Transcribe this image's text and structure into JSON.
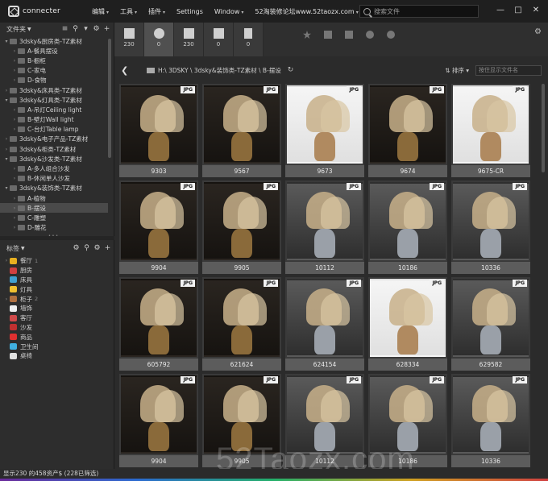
{
  "app": {
    "name": "connecter"
  },
  "menu": [
    {
      "label": "编辑",
      "caret": true
    },
    {
      "label": "工具",
      "caret": true
    },
    {
      "label": "插件",
      "caret": true
    },
    {
      "label": "Settings",
      "caret": false
    },
    {
      "label": "Window",
      "caret": true
    },
    {
      "label": "52淘装修论坛www.52taozx.com",
      "caret": true
    }
  ],
  "search": {
    "placeholder": "搜索文件"
  },
  "folders": {
    "title": "文件夹",
    "items": [
      {
        "label": "3dsky&厨房类-TZ素材",
        "level": 0,
        "expanded": true
      },
      {
        "label": "A-餐具摆设",
        "level": 1
      },
      {
        "label": "B-橱柜",
        "level": 1
      },
      {
        "label": "C-家电",
        "level": 1
      },
      {
        "label": "D-食物",
        "level": 1
      },
      {
        "label": "3dsky&床具类-TZ素材",
        "level": 0
      },
      {
        "label": "3dsky&灯具类-TZ素材",
        "level": 0,
        "expanded": true
      },
      {
        "label": "A-吊灯Ceiling light",
        "level": 1
      },
      {
        "label": "B-壁灯Wall light",
        "level": 1
      },
      {
        "label": "C-台灯Table lamp",
        "level": 1
      },
      {
        "label": "3dsky&电子产品-TZ素材",
        "level": 0
      },
      {
        "label": "3dsky&柜类-TZ素材",
        "level": 0
      },
      {
        "label": "3dsky&沙发类-TZ素材",
        "level": 0,
        "expanded": true
      },
      {
        "label": "A-多人组合沙发",
        "level": 1
      },
      {
        "label": "B-休闲单人沙发",
        "level": 1
      },
      {
        "label": "3dsky&装饰类-TZ素材",
        "level": 0,
        "expanded": true
      },
      {
        "label": "A-植物",
        "level": 1
      },
      {
        "label": "B-摆设",
        "level": 1,
        "selected": true
      },
      {
        "label": "C-雕塑",
        "level": 1
      },
      {
        "label": "D-雕花",
        "level": 1
      }
    ]
  },
  "tags": {
    "title": "标签",
    "items": [
      {
        "label": "餐厅",
        "count": "1",
        "color": "#e8b020",
        "expandable": true
      },
      {
        "label": "厨房",
        "count": "",
        "color": "#d04040",
        "expandable": false
      },
      {
        "label": "床具",
        "count": "",
        "color": "#40a0d0",
        "expandable": false
      },
      {
        "label": "灯具",
        "count": "",
        "color": "#f0c030",
        "expandable": false
      },
      {
        "label": "柜子",
        "count": "2",
        "color": "#b07040",
        "expandable": true
      },
      {
        "label": "墙饰",
        "count": "",
        "color": "#f0f0f0",
        "expandable": false
      },
      {
        "label": "客厅",
        "count": "",
        "color": "#d04a4a",
        "expandable": false
      },
      {
        "label": "沙发",
        "count": "",
        "color": "#c03030",
        "expandable": false
      },
      {
        "label": "商品",
        "count": "",
        "color": "#e03030",
        "expandable": false
      },
      {
        "label": "卫生间",
        "count": "",
        "color": "#40b0e0",
        "expandable": false
      },
      {
        "label": "桌椅",
        "count": "",
        "color": "#e0e0e0",
        "expandable": false
      }
    ]
  },
  "filter_tabs": [
    {
      "icon": "box-icon",
      "count": "230",
      "active": false
    },
    {
      "icon": "sphere-icon",
      "count": "0",
      "active": true
    },
    {
      "icon": "image-icon",
      "count": "230",
      "active": false
    },
    {
      "icon": "film-icon",
      "count": "0",
      "active": false
    },
    {
      "icon": "document-icon",
      "count": "0",
      "active": false
    }
  ],
  "filter_icons": [
    "star-icon",
    "tag-icon",
    "list-icon",
    "camera-icon",
    "ban-icon"
  ],
  "path": {
    "text": "H:\\ 3DSKY \\ 3dsky&装饰类-TZ素材 \\ B-摆设"
  },
  "sort": {
    "label": "排序"
  },
  "name_filter": {
    "placeholder": "按住显示文件名"
  },
  "thumbnails": [
    {
      "name": "9303",
      "type": "JPG",
      "scene": "dk"
    },
    {
      "name": "9567",
      "type": "JPG",
      "scene": "dk"
    },
    {
      "name": "9673",
      "type": "JPG",
      "scene": "wh"
    },
    {
      "name": "9674",
      "type": "JPG",
      "scene": "dk"
    },
    {
      "name": "9675-CR",
      "type": "JPG",
      "scene": "wh"
    },
    {
      "name": "9904",
      "type": "JPG",
      "scene": "dk"
    },
    {
      "name": "9905",
      "type": "JPG",
      "scene": "dk"
    },
    {
      "name": "10112",
      "type": "JPG",
      "scene": "gr"
    },
    {
      "name": "10186",
      "type": "JPG",
      "scene": "gr"
    },
    {
      "name": "10336",
      "type": "JPG",
      "scene": "gr"
    },
    {
      "name": "605792",
      "type": "JPG",
      "scene": "dk"
    },
    {
      "name": "621624",
      "type": "JPG",
      "scene": "dk"
    },
    {
      "name": "624154",
      "type": "JPG",
      "scene": "gr"
    },
    {
      "name": "628334",
      "type": "JPG",
      "scene": "wh"
    },
    {
      "name": "629582",
      "type": "JPG",
      "scene": "gr"
    },
    {
      "name": "9904",
      "type": "JPG",
      "scene": "dk"
    },
    {
      "name": "9905",
      "type": "JPG",
      "scene": "dk"
    },
    {
      "name": "10112",
      "type": "JPG",
      "scene": "gr"
    },
    {
      "name": "10186",
      "type": "JPG",
      "scene": "gr"
    },
    {
      "name": "10336",
      "type": "JPG",
      "scene": "gr"
    }
  ],
  "status": {
    "text": "显示230 的458资产$  (228已筛选)"
  },
  "watermark": {
    "text": "52Taozx.com"
  }
}
